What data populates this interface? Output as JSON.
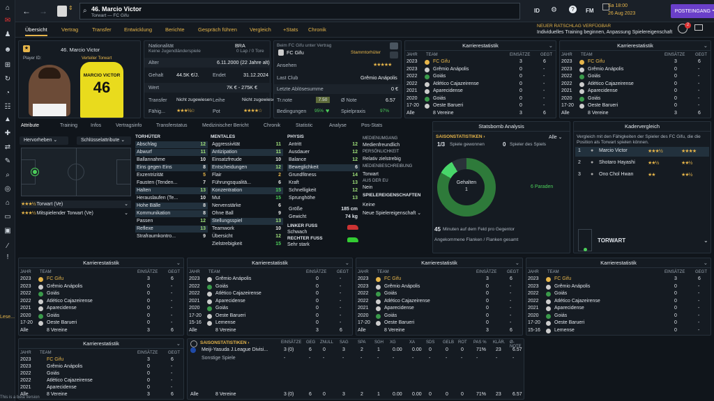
{
  "header": {
    "number_name": "46. Marcio Victor",
    "subtitle": "Torwart — FC Gifu",
    "date": "Sa 18:00",
    "date2": "26 Aug 2023",
    "continue": "POSTEINGANG",
    "advice_title": "NEUER RATSCHLAG VERFÜGBAR",
    "advice_text": "Individuelles Training beginnen, Anpassung Spielereigenschaft",
    "id_label": "ID",
    "fm_label": "FM",
    "notif_count": "2"
  },
  "nav": [
    "Übersicht",
    "Vertrag",
    "Transfer",
    "Entwicklung",
    "Berichte",
    "Gespräch führen",
    "Vergleich",
    "+Stats",
    "Chronik"
  ],
  "profile": {
    "name": "46. Marcio Victor",
    "playerid": "Player ID:",
    "role": "Verteiler Torwart",
    "shirt_name": "MARCIO VICTOR",
    "shirt_num": "46"
  },
  "info": {
    "nationality_l": "Nationalität",
    "nationality_v": "BRA",
    "nat_sub": "Keine Jugendländerspiele",
    "nat_sub2": "0 Lap / 0 Tore",
    "age_l": "Alter",
    "age_v": "6.11.2000 (22 Jahre alt)",
    "salary_l": "Gehalt",
    "salary_v": "44.5K €/J.",
    "end_l": "Endet",
    "end_v": "31.12.2024",
    "value_l": "Wert",
    "value_v": "7K € - 275K €",
    "transfer_l": "Transfer",
    "transfer_v": "Nicht zugewiesen",
    "loan_l": "Leihe",
    "loan_v": "Nicht zugewiesen",
    "ability_l": "Fähig...",
    "pot_l": "Pot",
    "club_l": "Beim FC Gifu unter Vertrag",
    "club_v": "FC Gifu",
    "club_role": "Stammtorhüter",
    "club_badge_l": "",
    "reputation_l": "Ansehen",
    "lastclub_l": "Last Club",
    "lastclub_v": "Grêmio Anápolis",
    "lastfee_l": "Letzte Ablösesumme",
    "lastfee_v": "0 €",
    "trnote_l": "Tr.note",
    "trnote_v": "7.50",
    "note_l": "Ø Note",
    "note_v": "6.57",
    "cond_l": "Bedingungen",
    "cond_v": "95%",
    "match_l": "Spielpraxis",
    "match_v": "97%"
  },
  "tabs": [
    "Attribute",
    "Training",
    "Infos",
    "Vertragsinfo",
    "Transferstatus",
    "Medizinischer Bericht",
    "Chronik",
    "Statistic",
    "Analyse",
    "Pos-Stats"
  ],
  "pitch": {
    "highlight": "Hervorheben",
    "keyattr": "Schlüsselattribute",
    "pos1": "Torwart (Ve)",
    "pos2": "Mitspielender Torwart (Ve)"
  },
  "attrs": {
    "gk_title": "TORHÜTER",
    "gk": [
      [
        "Abschlag",
        "12"
      ],
      [
        "Abwurf",
        "11"
      ],
      [
        "Ballannahme",
        "10"
      ],
      [
        "Eins gegen Eins",
        "8"
      ],
      [
        "Exzentrizität",
        "5"
      ],
      [
        "Fausten (Tenden...",
        "7"
      ],
      [
        "Halten",
        "13"
      ],
      [
        "Herauslaufen (Te...",
        "10"
      ],
      [
        "Hohe Bälle",
        "8"
      ],
      [
        "Kommunikation",
        "8"
      ],
      [
        "Passen",
        "12"
      ],
      [
        "Reflexe",
        "13"
      ],
      [
        "Strafraumkontro...",
        "9"
      ]
    ],
    "mental_title": "MENTALES",
    "mental": [
      [
        "Aggressivität",
        "11"
      ],
      [
        "Antizipation",
        "11"
      ],
      [
        "Einsatzfreude",
        "10"
      ],
      [
        "Entscheidungen",
        "12"
      ],
      [
        "Flair",
        "2"
      ],
      [
        "Führungsqualitä...",
        "6"
      ],
      [
        "Konzentration",
        "15"
      ],
      [
        "Mut",
        "15"
      ],
      [
        "Nervenstärke",
        "6"
      ],
      [
        "Ohne Ball",
        "9"
      ],
      [
        "Stellungsspiel",
        "13"
      ],
      [
        "Teamwork",
        "10"
      ],
      [
        "Übersicht",
        "12"
      ],
      [
        "Zielstrebigkeit",
        "15"
      ]
    ],
    "phys_title": "PHYSIS",
    "phys": [
      [
        "Antritt",
        "12"
      ],
      [
        "Ausdauer",
        "12"
      ],
      [
        "Balance",
        "12"
      ],
      [
        "Beweglichkeit",
        "6"
      ],
      [
        "Grundfitness",
        "14"
      ],
      [
        "Kraft",
        "13"
      ],
      [
        "Schnelligkeit",
        "12"
      ],
      [
        "Sprunghöhe",
        "13"
      ]
    ],
    "height_l": "Größe",
    "height_v": "185 cm",
    "weight_l": "Gewicht",
    "weight_v": "74 kg",
    "lfoot_l": "LINKER FUSS",
    "lfoot_v": "Schwach",
    "rfoot_l": "RECHTER FUSS",
    "rfoot_v": "Sehr stark"
  },
  "media": {
    "t1": "MEDIENUMGANG",
    "v1": "Medienfreundlich",
    "t2": "PERSÖNLICHKEIT",
    "v2": "Relativ zielstrebig",
    "t3": "MEDIENBESCHREIBUNG",
    "v3": "Torwart",
    "t4": "AUS DER EU",
    "v4": "Nein",
    "t5": "SPIELEREIGENSCHAFTEN",
    "v5": "Keine",
    "v6": "Neue Spielereigenschaft"
  },
  "statsbomb": {
    "title": "Statsbomb Analysis",
    "filter": "Alle",
    "season": "SAISONSTATISTIKEN",
    "won": "1/3",
    "won_l": "Spiele gewonnen",
    "games": "0",
    "games_l": "Spieler des Spiels",
    "held": "Gehalten",
    "held_n": "1",
    "saves": "6 Paraden",
    "minutes": "45",
    "minutes_l": "Minuten auf dem Feld pro Gegentor",
    "crosses": "Angekommene Flanken / Flanken gesamt"
  },
  "squad": {
    "title": "Kadervergleich",
    "desc": "Vergleich mit den Fähigkeiten der Spieler des FC Gifu, die die Position als Torwart spielen können.",
    "rows": [
      [
        "1",
        "Marcio Victor"
      ],
      [
        "2",
        "Shotaro Hayashi"
      ],
      [
        "3",
        "Ono Chol Hwan"
      ]
    ],
    "pos": "TORWART"
  },
  "career": {
    "title": "Karrierestatistik",
    "h_year": "JAHR",
    "h_team": "TEAM",
    "h_apps": "EINSÄTZE",
    "h_goals": "GEGT",
    "rows": [
      [
        "2023",
        "FC Gifu",
        "3",
        "6"
      ],
      [
        "2023",
        "Grêmio Anápolis",
        "0",
        "-"
      ],
      [
        "2022",
        "Goiás",
        "0",
        "-"
      ],
      [
        "2022",
        "Atlético Cajazeirense",
        "0",
        "-"
      ],
      [
        "2021",
        "Aparecidense",
        "0",
        "-"
      ],
      [
        "2020",
        "Goiás",
        "0",
        "-"
      ],
      [
        "17-20",
        "Oeste Barueri",
        "0",
        "-"
      ],
      [
        "Alle",
        "8 Vereine",
        "3",
        "6"
      ]
    ],
    "rows_b": [
      [
        "2023",
        "Grêmio Anápolis",
        "0",
        "-"
      ],
      [
        "2022",
        "Goiás",
        "0",
        "-"
      ],
      [
        "2022",
        "Atlético Cajazeirense",
        "0",
        "-"
      ],
      [
        "2021",
        "Aparecidense",
        "0",
        "-"
      ],
      [
        "2020",
        "Goiás",
        "0",
        "-"
      ],
      [
        "17-20",
        "Oeste Barueri",
        "0",
        "-"
      ],
      [
        "15-16",
        "Lemense",
        "0",
        "-"
      ],
      [
        "Alle",
        "8 Vereine",
        "3",
        "6"
      ]
    ],
    "rows_d": [
      [
        "2023",
        "FC Gifu",
        "3",
        "6"
      ],
      [
        "2023",
        "Grêmio Anápolis",
        "0",
        "-"
      ],
      [
        "2022",
        "Goiás",
        "0",
        "-"
      ],
      [
        "2022",
        "Atlético Cajazeirense",
        "0",
        "-"
      ],
      [
        "2021",
        "Aparecidense",
        "0",
        "-"
      ],
      [
        "2020",
        "Goiás",
        "0",
        "-"
      ],
      [
        "17-20",
        "Oeste Barueri",
        "0",
        "-"
      ],
      [
        "15-16",
        "Lemense",
        "0",
        "-"
      ]
    ],
    "rows_e": [
      [
        "2023",
        "FC Gifu",
        "3",
        "6"
      ],
      [
        "2023",
        "Grêmio Anápolis",
        "0",
        "-"
      ],
      [
        "2022",
        "Goiás",
        "0",
        "-"
      ],
      [
        "2022",
        "Atlético Cajazeirense",
        "0",
        "-"
      ],
      [
        "2021",
        "Aparecidense",
        "0",
        "-"
      ],
      [
        "2020",
        "Goiás",
        "0",
        "-"
      ],
      [
        "17-20",
        "Oeste Barueri",
        "0",
        "-"
      ],
      [
        "Alle",
        "8 Vereine",
        "3",
        "6"
      ]
    ]
  },
  "season": {
    "title": "SAISONSTATISTIKEN",
    "headers": [
      "EINSÄTZE",
      "GEG",
      "ZNULL",
      "SAG",
      "SPA",
      "SGH",
      "XG",
      "XA",
      "SDS",
      "GELB",
      "ROT",
      "PAS %",
      "KLÄR.",
      "Ø-NOTE"
    ],
    "league": "Meiji-Yasuda J.League Divisi...",
    "league_v": [
      "3 (0)",
      "6",
      "0",
      "3",
      "2",
      "1",
      "0.00",
      "0.00",
      "0",
      "0",
      "0",
      "71%",
      "23",
      "6.57"
    ],
    "other": "Sonstige Spiele",
    "other_v": [
      "-",
      "-",
      "-",
      "-",
      "-",
      "-",
      "-",
      "-",
      "-",
      "-",
      "-",
      "-",
      "-",
      "-"
    ],
    "total_v": [
      "3 (0)",
      "6",
      "0",
      "3",
      "2",
      "1",
      "0.00",
      "0.00",
      "0",
      "0",
      "0",
      "71%",
      "23",
      "6.57"
    ],
    "club_count": "8 Vereine",
    "alle": "Alle"
  },
  "footer": {
    "beta": "This is a beta version",
    "lese": "Lese..."
  }
}
